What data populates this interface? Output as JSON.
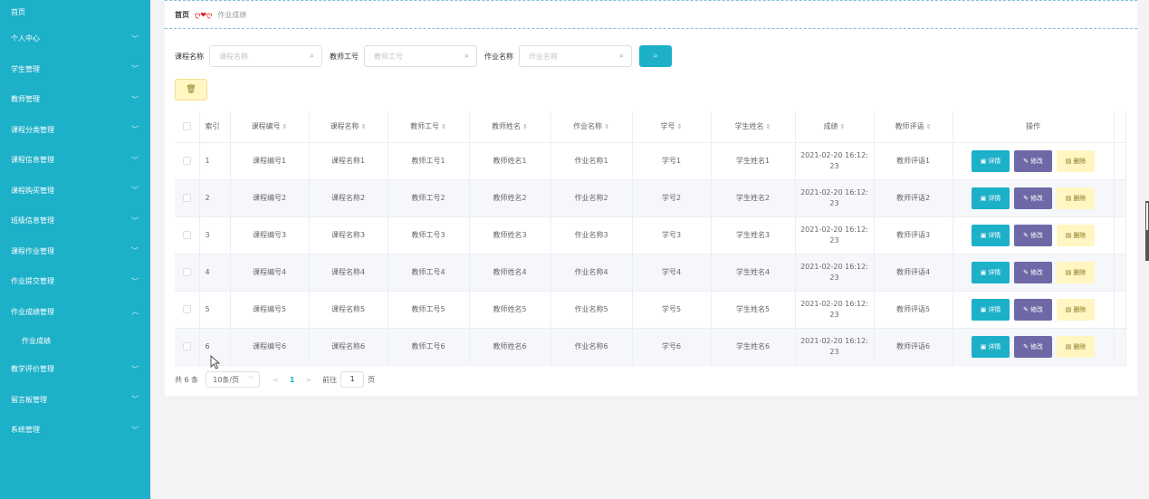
{
  "sidebar": {
    "home": "首页",
    "items": [
      {
        "label": "个人中心",
        "chevron": "﹀"
      },
      {
        "label": "学生管理",
        "chevron": "﹀"
      },
      {
        "label": "教师管理",
        "chevron": "﹀"
      },
      {
        "label": "课程分类管理",
        "chevron": "﹀"
      },
      {
        "label": "课程信息管理",
        "chevron": "﹀"
      },
      {
        "label": "课程购买管理",
        "chevron": "﹀"
      },
      {
        "label": "班级信息管理",
        "chevron": "﹀"
      },
      {
        "label": "课程作业管理",
        "chevron": "﹀"
      },
      {
        "label": "作业提交管理",
        "chevron": "﹀"
      },
      {
        "label": "作业成绩管理",
        "chevron": "︿"
      },
      {
        "label": "教学评价管理",
        "chevron": "﹀"
      },
      {
        "label": "留言板管理",
        "chevron": "﹀"
      },
      {
        "label": "系统管理",
        "chevron": "﹀"
      }
    ],
    "sub_item": "作业成绩"
  },
  "breadcrumb": {
    "home": "首页",
    "deco": "ღ❤ღ",
    "current": "作业成绩"
  },
  "search": {
    "course_name_label": "课程名称",
    "course_name_placeholder": "课程名称",
    "teacher_id_label": "教师工号",
    "teacher_id_placeholder": "教师工号",
    "homework_name_label": "作业名称",
    "homework_name_placeholder": "作业名称",
    "search_icon": "⌕"
  },
  "toolbar": {
    "delete_icon": "🗑"
  },
  "table": {
    "headers": {
      "index": "索引",
      "course_code": "课程编号",
      "course_name": "课程名称",
      "teacher_id": "教师工号",
      "teacher_name": "教师姓名",
      "homework_name": "作业名称",
      "student_id": "学号",
      "student_name": "学生姓名",
      "score": "成绩",
      "teacher_comment": "教师评语",
      "actions": "操作"
    },
    "sort_icon": "⇕",
    "actions": {
      "detail": "详情",
      "edit": "修改",
      "delete": "删除"
    },
    "rows": [
      {
        "index": "1",
        "course_code": "课程编号1",
        "course_name": "课程名称1",
        "teacher_id": "教师工号1",
        "teacher_name": "教师姓名1",
        "homework_name": "作业名称1",
        "student_id": "学号1",
        "student_name": "学生姓名1",
        "score_line1": "2021-02-20 16:12:",
        "score_line2": "23",
        "teacher_comment": "教师评语1"
      },
      {
        "index": "2",
        "course_code": "课程编号2",
        "course_name": "课程名称2",
        "teacher_id": "教师工号2",
        "teacher_name": "教师姓名2",
        "homework_name": "作业名称2",
        "student_id": "学号2",
        "student_name": "学生姓名2",
        "score_line1": "2021-02-20 16:12:",
        "score_line2": "23",
        "teacher_comment": "教师评语2"
      },
      {
        "index": "3",
        "course_code": "课程编号3",
        "course_name": "课程名称3",
        "teacher_id": "教师工号3",
        "teacher_name": "教师姓名3",
        "homework_name": "作业名称3",
        "student_id": "学号3",
        "student_name": "学生姓名3",
        "score_line1": "2021-02-20 16:12:",
        "score_line2": "23",
        "teacher_comment": "教师评语3"
      },
      {
        "index": "4",
        "course_code": "课程编号4",
        "course_name": "课程名称4",
        "teacher_id": "教师工号4",
        "teacher_name": "教师姓名4",
        "homework_name": "作业名称4",
        "student_id": "学号4",
        "student_name": "学生姓名4",
        "score_line1": "2021-02-20 16:12:",
        "score_line2": "23",
        "teacher_comment": "教师评语4"
      },
      {
        "index": "5",
        "course_code": "课程编号5",
        "course_name": "课程名称5",
        "teacher_id": "教师工号5",
        "teacher_name": "教师姓名5",
        "homework_name": "作业名称5",
        "student_id": "学号5",
        "student_name": "学生姓名5",
        "score_line1": "2021-02-20 16:12:",
        "score_line2": "23",
        "teacher_comment": "教师评语5"
      },
      {
        "index": "6",
        "course_code": "课程编号6",
        "course_name": "课程名称6",
        "teacher_id": "教师工号6",
        "teacher_name": "教师姓名6",
        "homework_name": "作业名称6",
        "student_id": "学号6",
        "student_name": "学生姓名6",
        "score_line1": "2021-02-20 16:12:",
        "score_line2": "23",
        "teacher_comment": "教师评语6"
      }
    ]
  },
  "pagination": {
    "total": "共 6 条",
    "page_size": "10条/页",
    "prev": "<",
    "current_page": "1",
    "next": ">",
    "goto_label": "前往",
    "goto_value": "1",
    "page_suffix": "页"
  },
  "colors": {
    "accent": "#1cb0c9",
    "edit_button": "#6e69a6",
    "delete_button": "#fff6c2"
  }
}
